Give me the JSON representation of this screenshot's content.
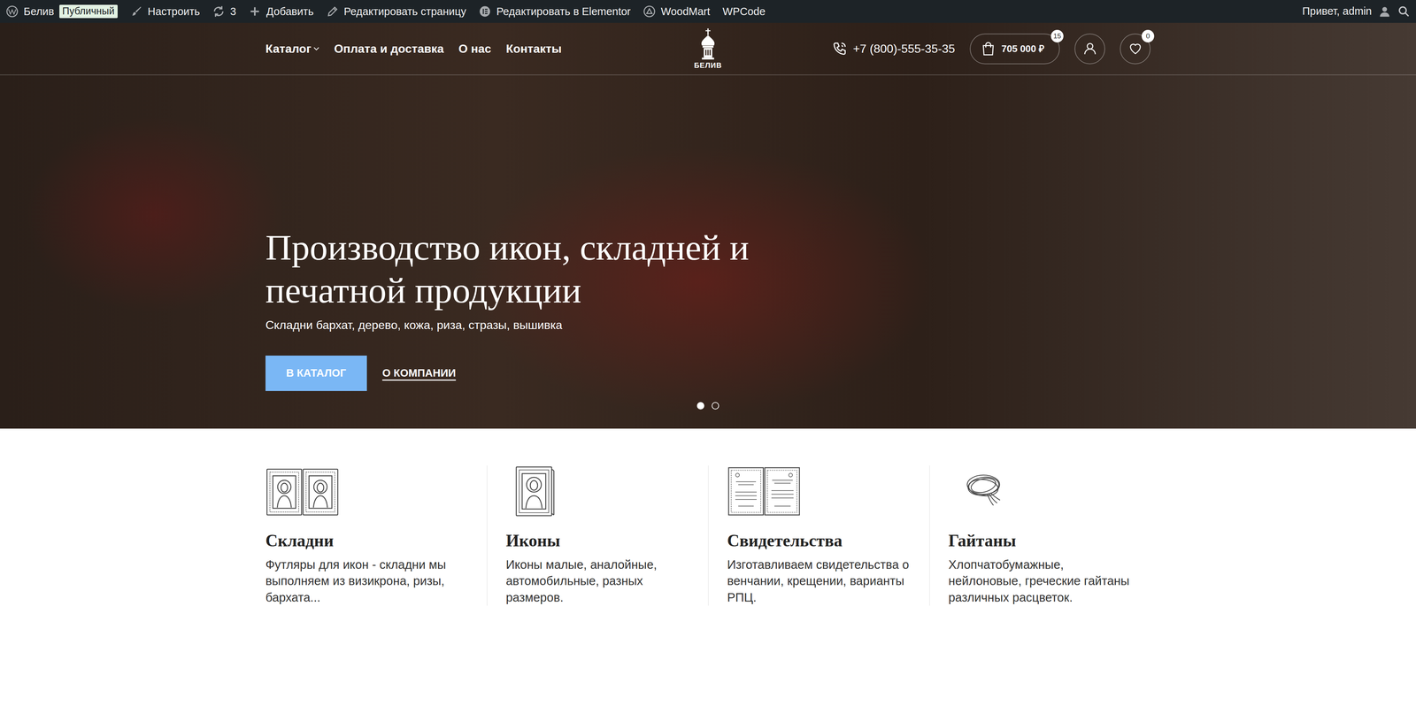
{
  "admin_bar": {
    "items": [
      {
        "kind": "site",
        "label": "Белив",
        "badge": "Публичный"
      },
      {
        "kind": "customize",
        "label": "Настроить"
      },
      {
        "kind": "updates",
        "label": "3"
      },
      {
        "kind": "add",
        "label": "Добавить"
      },
      {
        "kind": "edit",
        "label": "Редактировать страницу"
      },
      {
        "kind": "elementor",
        "label": "Редактировать в Elementor"
      },
      {
        "kind": "woodmart",
        "label": "WoodMart"
      },
      {
        "kind": "plain",
        "label": "WPCode"
      }
    ],
    "greeting": "Привет, admin"
  },
  "header": {
    "nav": [
      {
        "label": "Каталог",
        "dropdown": true
      },
      {
        "label": "Оплата и доставка",
        "dropdown": false
      },
      {
        "label": "О нас",
        "dropdown": false
      },
      {
        "label": "Контакты",
        "dropdown": false
      }
    ],
    "logo": "БЕЛИВ",
    "phone": "+7 (800)-555-35-35",
    "cart": {
      "total": "705 000 ₽",
      "count": "15"
    },
    "wishlist": {
      "count": "0"
    }
  },
  "hero": {
    "title": "Производство икон, складней и печатной продукции",
    "subtitle": "Складни бархат, дерево, кожа, риза, стразы, вышивка",
    "buttons": [
      {
        "label": "В КАТАЛОГ",
        "kind": "primary"
      },
      {
        "label": "О КОМПАНИИ",
        "kind": "link"
      }
    ],
    "slides": [
      {
        "selected": true
      },
      {
        "selected": false
      }
    ]
  },
  "features": [
    {
      "kind": "folding",
      "title": "Складни",
      "text": "Футляры для икон - складни мы выполняем из визикрона, ризы, бархата..."
    },
    {
      "kind": "icon",
      "title": "Иконы",
      "text": "Иконы малые, аналойные, автомобильные, разных размеров."
    },
    {
      "kind": "certificate",
      "title": "Свидетельства",
      "text": "Изготавливаем свидетельства о венчании, крещении, варианты РПЦ."
    },
    {
      "kind": "cord",
      "title": "Гайтаны",
      "text": "Хлопчатобумажные, нейлоновые, греческие гайтаны различных расцветок."
    }
  ]
}
